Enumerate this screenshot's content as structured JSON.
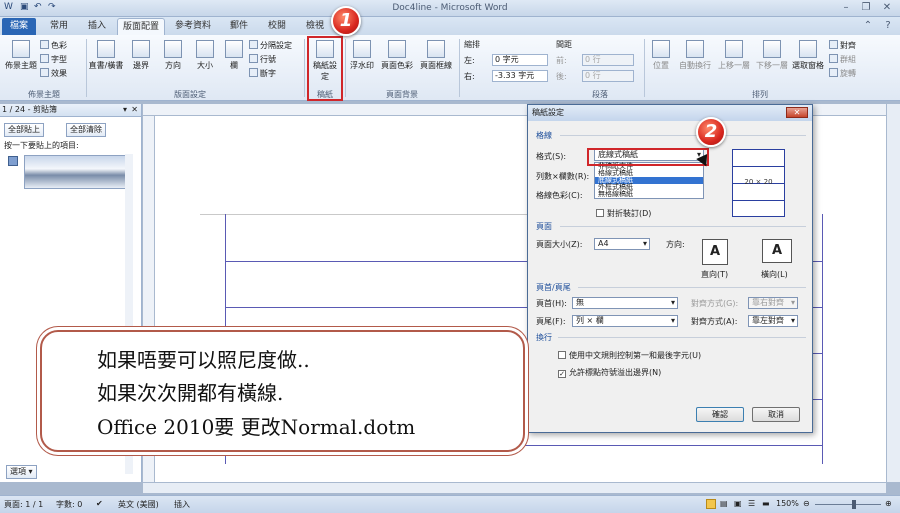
{
  "window": {
    "title": "Doc4line - Microsoft Word"
  },
  "tabs": [
    {
      "label": "檔案"
    },
    {
      "label": "常用"
    },
    {
      "label": "插入"
    },
    {
      "label": "版面配置"
    },
    {
      "label": "參考資料"
    },
    {
      "label": "郵件"
    },
    {
      "label": "校閱"
    },
    {
      "label": "檢視"
    }
  ],
  "ribbon": {
    "theme": {
      "main": "佈景主題",
      "colors": "色彩",
      "fonts": "字型",
      "effects": "效果",
      "group": "佈景主題"
    },
    "page_setup": {
      "margins": "邊界",
      "orientation": "方向",
      "size": "大小",
      "columns": "欄",
      "breaks": "分隔設定",
      "line_numbers": "行號",
      "hyphenation": "斷字",
      "group": "版面設定",
      "text_dir": "直書/橫書"
    },
    "manuscript": {
      "label": "稿紙設定",
      "group": "稿紙"
    },
    "page_bg": {
      "watermark": "浮水印",
      "page_color": "頁面色彩",
      "page_borders": "頁面框線",
      "group": "頁面背景"
    },
    "paragraph": {
      "indent": "縮排",
      "spacing": "間距",
      "left": "左:",
      "right": "右:",
      "left_val": "0 字元",
      "right_val": "-3.33 字元",
      "before": "前:",
      "after": "後:",
      "before_val": "0 行",
      "after_val": "0 行",
      "group": "段落"
    },
    "arrange": {
      "position": "位置",
      "wrap": "自動換行",
      "forward": "上移一層",
      "backward": "下移一層",
      "selection": "選取窗格",
      "align": "對齊",
      "group_btn": "群組",
      "rotate": "旋轉",
      "group": "排列"
    }
  },
  "clipboard": {
    "header": "1 / 24 - 剪貼簿",
    "paste_all": "全部貼上",
    "clear_all": "全部清除",
    "hint": "按一下要貼上的項目:",
    "options": "選項"
  },
  "dialog": {
    "title": "稿紙設定",
    "sec_grid": "格線",
    "format_label": "格式(S):",
    "format_value": "底線式稿紙",
    "format_options": [
      "非稿紙文件",
      "格線式稿紙",
      "底線式稿紙",
      "外框式稿紙",
      "無格線稿紙"
    ],
    "rows_label": "列數×欄數(R):",
    "color_label": "格線色彩(C):",
    "grid_size": "20 × 20",
    "fold_label": "對折裝訂(D)",
    "sec_page": "頁面",
    "size_label": "頁面大小(Z):",
    "size_value": "A4",
    "orient_label": "方向:",
    "portrait": "直向(T)",
    "landscape": "橫向(L)",
    "sec_hf": "頁首/頁尾",
    "header_label": "頁首(H):",
    "header_value": "無",
    "footer_label": "頁尾(F):",
    "footer_value": "列 × 欄",
    "align_label": "對齊方式(G):",
    "align_label2": "對齊方式(A):",
    "align_value": "靠右對齊",
    "align_value2": "靠左對齊",
    "sec_wrap": "換行",
    "opt1": "使用中文規則控制第一和最後字元(U)",
    "opt2": "允許標點符號溢出邊界(N)",
    "ok": "確認",
    "cancel": "取消"
  },
  "callout": {
    "line1": "如果唔要可以照尼度做..",
    "line2": "如果次次開都有橫線.",
    "line3": "Office 2010要 更改Normal.dotm"
  },
  "badges": {
    "one": "1",
    "two": "2"
  },
  "status": {
    "page": "頁面: 1 / 1",
    "words": "字數: 0",
    "lang": "英文 (美國)",
    "mode": "插入",
    "zoom": "150%"
  }
}
